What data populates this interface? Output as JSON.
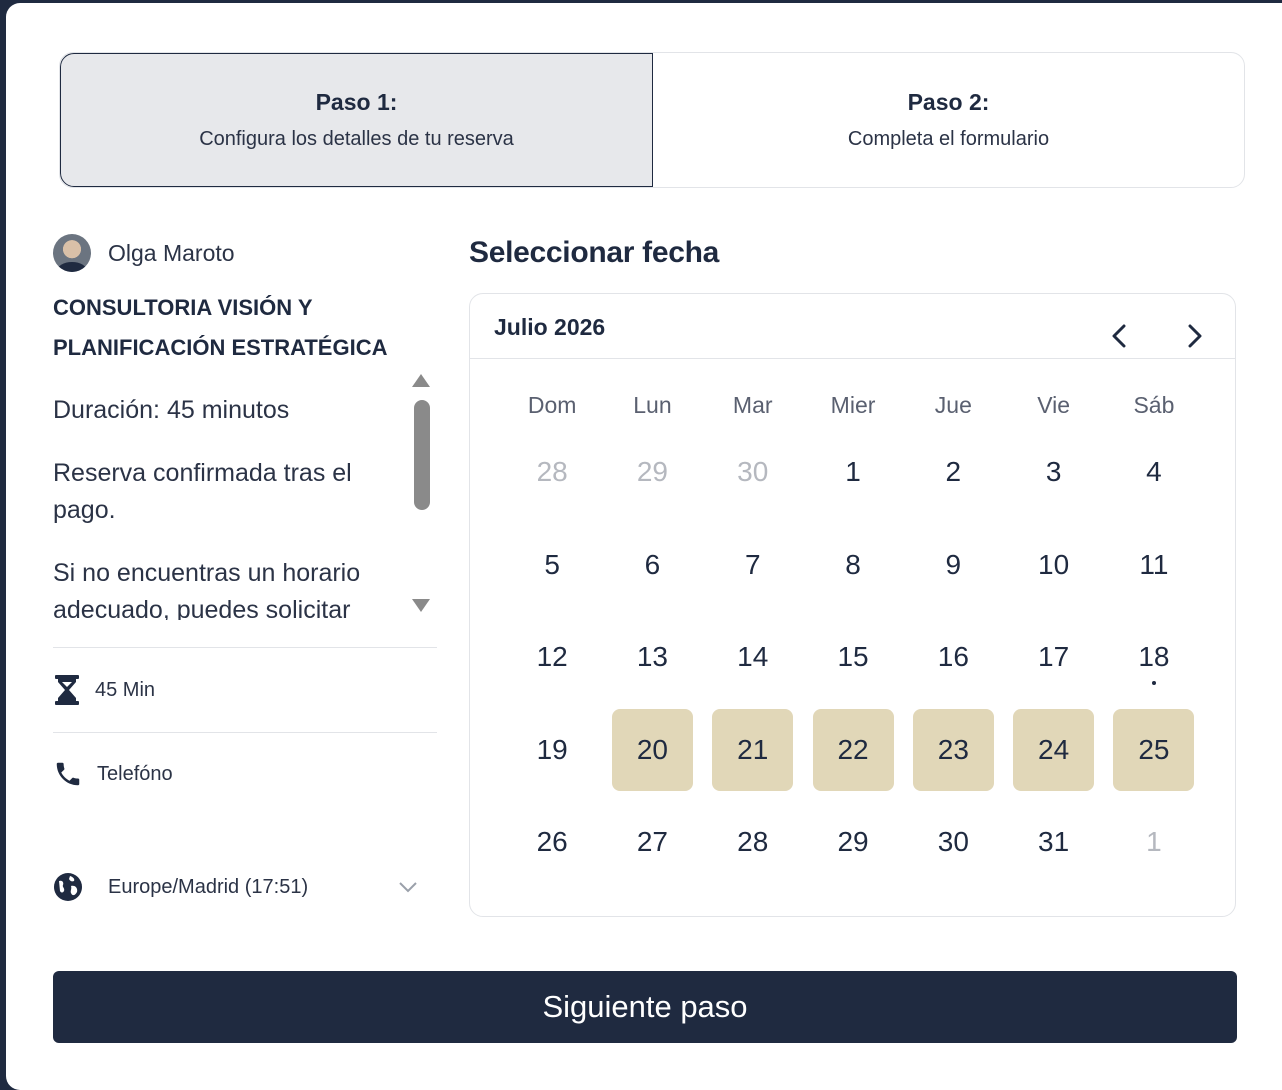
{
  "steps": [
    {
      "title": "Paso 1:",
      "subtitle": "Configura los detalles de tu reserva",
      "active": true
    },
    {
      "title": "Paso 2:",
      "subtitle": "Completa el formulario",
      "active": false
    }
  ],
  "host": {
    "name": "Olga Maroto"
  },
  "service": {
    "title": "CONSULTORIA VISIÓN Y PLANIFICACIÓN ESTRATÉGICA",
    "description": [
      "Duración: 45 minutos",
      "Reserva confirmada tras el pago.",
      "Si no encuentras un horario adecuado, puedes solicitar"
    ],
    "duration": "45 Min",
    "location": "Telefóno"
  },
  "timezone": {
    "label": "Europe/Madrid (17:51)"
  },
  "calendar": {
    "heading": "Seleccionar fecha",
    "month": "Julio 2026",
    "weekdays": [
      "Dom",
      "Lun",
      "Mar",
      "Mier",
      "Jue",
      "Vie",
      "Sáb"
    ],
    "weeks": [
      [
        {
          "d": "28",
          "m": true
        },
        {
          "d": "29",
          "m": true
        },
        {
          "d": "30",
          "m": true
        },
        {
          "d": "1"
        },
        {
          "d": "2"
        },
        {
          "d": "3"
        },
        {
          "d": "4"
        }
      ],
      [
        {
          "d": "5"
        },
        {
          "d": "6"
        },
        {
          "d": "7"
        },
        {
          "d": "8"
        },
        {
          "d": "9"
        },
        {
          "d": "10"
        },
        {
          "d": "11"
        }
      ],
      [
        {
          "d": "12"
        },
        {
          "d": "13"
        },
        {
          "d": "14"
        },
        {
          "d": "15"
        },
        {
          "d": "16"
        },
        {
          "d": "17"
        },
        {
          "d": "18",
          "today": true
        }
      ],
      [
        {
          "d": "19"
        },
        {
          "d": "20",
          "a": true
        },
        {
          "d": "21",
          "a": true
        },
        {
          "d": "22",
          "a": true
        },
        {
          "d": "23",
          "a": true
        },
        {
          "d": "24",
          "a": true
        },
        {
          "d": "25",
          "a": true
        }
      ],
      [
        {
          "d": "26"
        },
        {
          "d": "27"
        },
        {
          "d": "28"
        },
        {
          "d": "29"
        },
        {
          "d": "30"
        },
        {
          "d": "31"
        },
        {
          "d": "1",
          "m": true
        }
      ]
    ],
    "colors": {
      "available": "#e1d7b8",
      "muted": "#b5b8bf",
      "primary": "#1f2a40"
    }
  },
  "footer": {
    "next_label": "Siguiente paso"
  }
}
